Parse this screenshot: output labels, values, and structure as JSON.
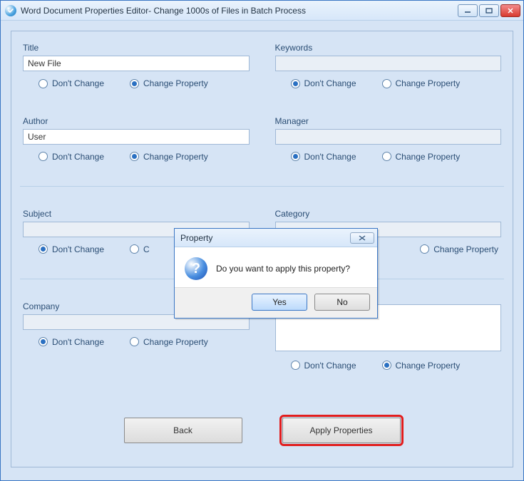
{
  "window": {
    "title": "Word Document Properties Editor- Change 1000s of Files in Batch Process"
  },
  "labels": {
    "dont_change": "Don't Change",
    "change_property": "Change Property"
  },
  "fields": {
    "title": {
      "label": "Title",
      "value": "New File",
      "selected": "change"
    },
    "keywords": {
      "label": "Keywords",
      "value": "",
      "selected": "dont"
    },
    "author": {
      "label": "Author",
      "value": "User",
      "selected": "change"
    },
    "manager": {
      "label": "Manager",
      "value": "",
      "selected": "dont"
    },
    "subject": {
      "label": "Subject",
      "value": "",
      "selected": "dont"
    },
    "category": {
      "label": "Category",
      "value": "",
      "selected": "dont"
    },
    "company": {
      "label": "Company",
      "value": "",
      "selected": "dont"
    },
    "comments": {
      "label": "",
      "value": "",
      "selected": "change"
    }
  },
  "buttons": {
    "back": "Back",
    "apply": "Apply Properties"
  },
  "dialog": {
    "title": "Property",
    "message": "Do you want to apply this property?",
    "yes": "Yes",
    "no": "No"
  }
}
